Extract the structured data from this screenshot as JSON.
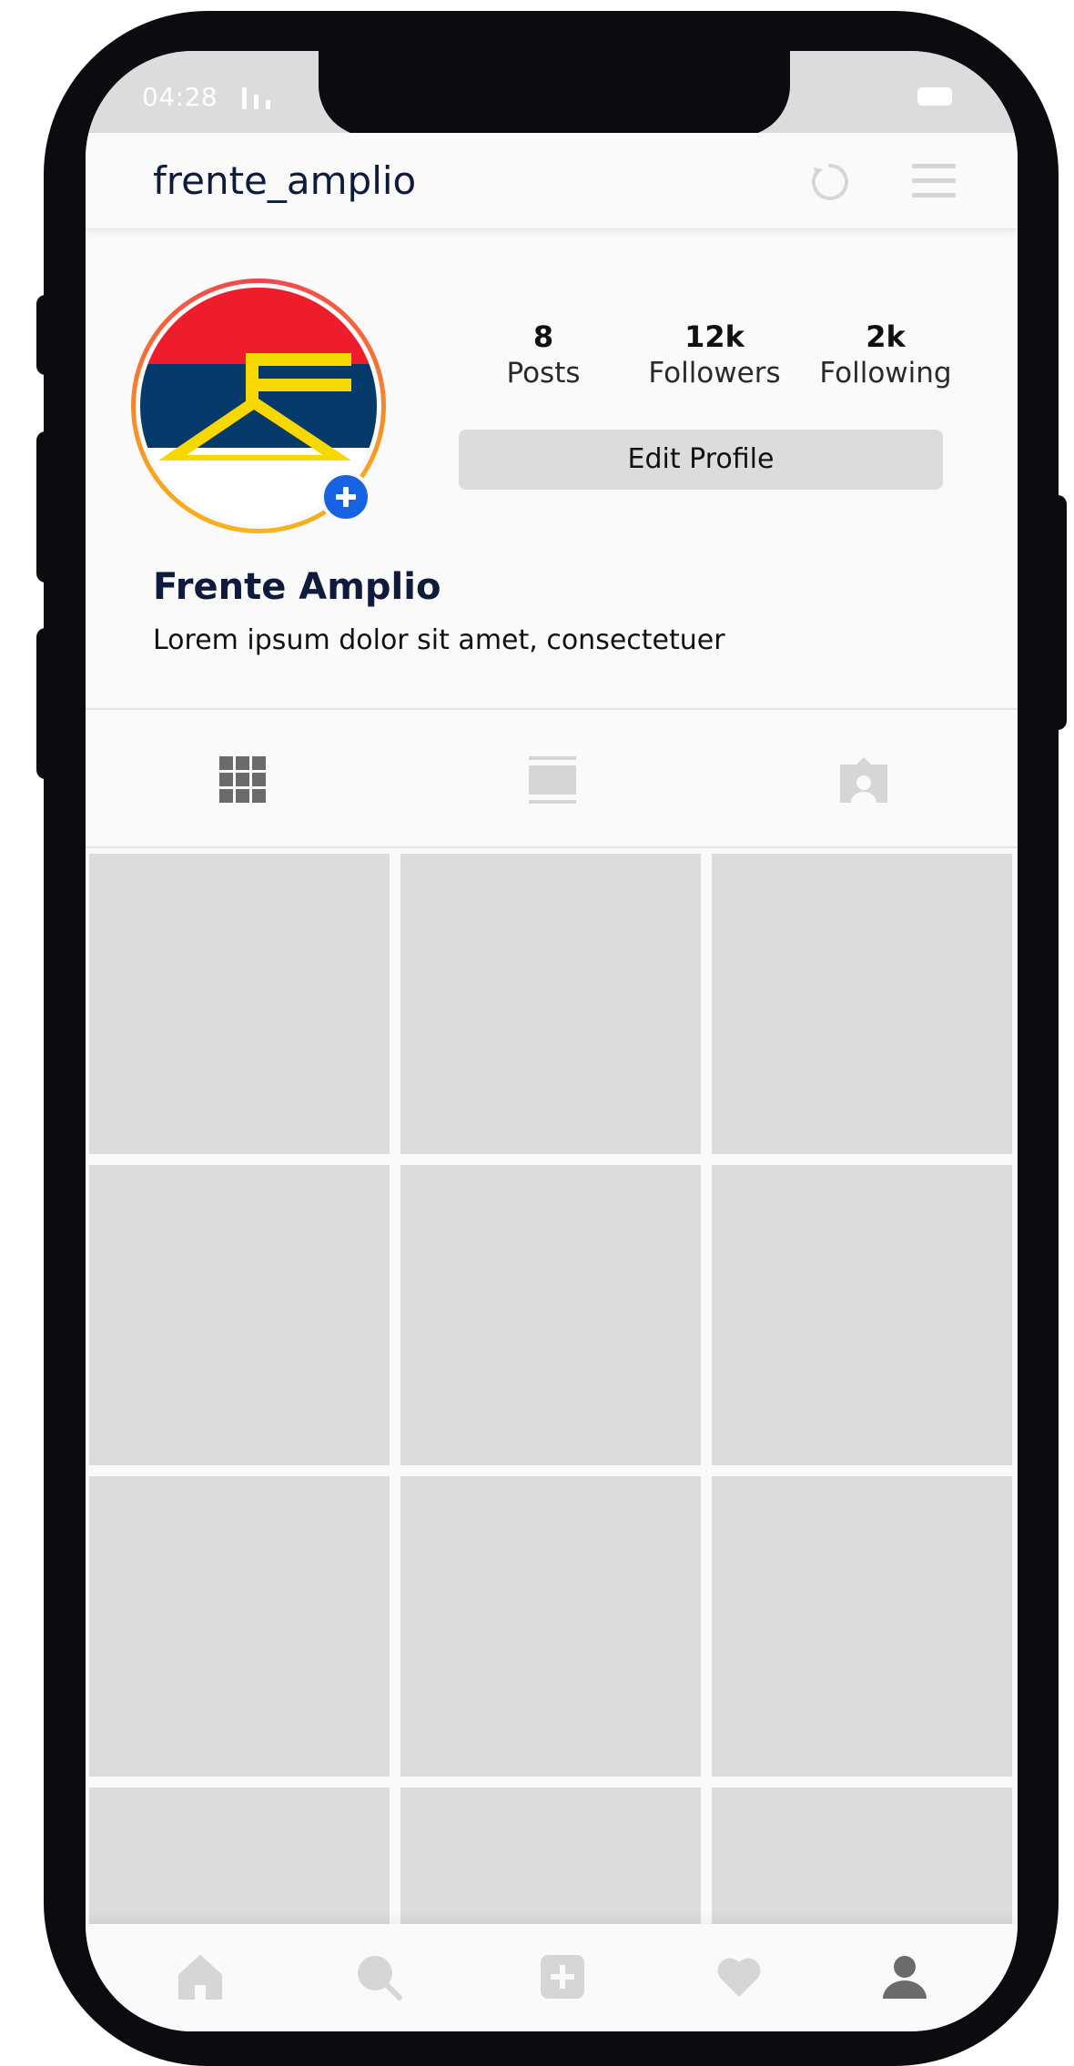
{
  "status_bar": {
    "time": "04:28",
    "signal_icon": "signal-bars-icon",
    "battery_icon": "battery-icon"
  },
  "header": {
    "username": "frente_amplio",
    "refresh_icon": "refresh-icon",
    "menu_icon": "hamburger-menu-icon"
  },
  "profile": {
    "avatar_alt": "Frente Amplio logo",
    "add_story_icon": "plus-icon",
    "stats": [
      {
        "value": "8",
        "label": "Posts"
      },
      {
        "value": "12k",
        "label": "Followers"
      },
      {
        "value": "2k",
        "label": "Following"
      }
    ],
    "edit_label": "Edit Profile",
    "display_name": "Frente Amplio",
    "bio": "Lorem ipsum dolor sit amet, consectetuer"
  },
  "tabs": [
    {
      "name": "grid",
      "icon": "grid-icon",
      "active": true
    },
    {
      "name": "feed",
      "icon": "feed-list-icon",
      "active": false
    },
    {
      "name": "tagged",
      "icon": "tagged-person-icon",
      "active": false
    }
  ],
  "posts_grid": {
    "rows_visible": 4,
    "columns": 3
  },
  "bottom_nav": [
    {
      "name": "home",
      "icon": "home-icon",
      "active": false
    },
    {
      "name": "search",
      "icon": "search-icon",
      "active": false
    },
    {
      "name": "add",
      "icon": "add-post-icon",
      "active": false
    },
    {
      "name": "activity",
      "icon": "heart-icon",
      "active": false
    },
    {
      "name": "profile",
      "icon": "profile-icon",
      "active": true
    }
  ],
  "colors": {
    "frame": "#0c0b10",
    "screen_bg": "#fafafa",
    "placeholder": "#dcdcdc",
    "text_dark": "#0f1b3a",
    "accent_blue": "#1763e3",
    "icon_inactive": "#d6d6d6",
    "icon_active": "#6b6b6b"
  }
}
